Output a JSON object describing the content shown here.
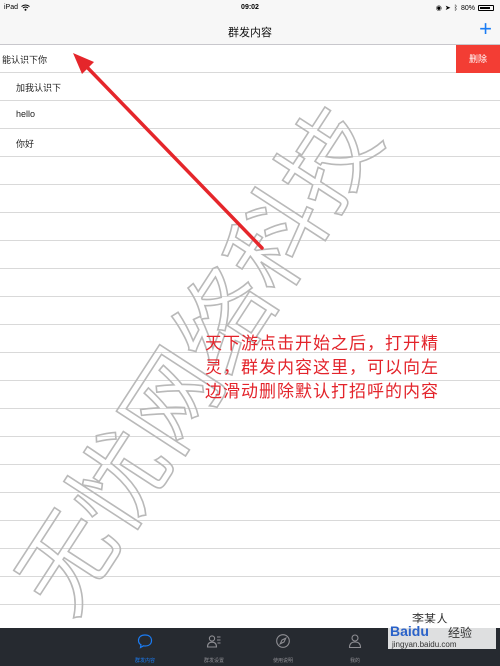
{
  "status_bar": {
    "device": "iPad",
    "time": "09:02",
    "battery": "80%"
  },
  "nav": {
    "title": "群发内容",
    "add_icon": "plus-icon"
  },
  "list": {
    "rows": [
      {
        "text": "能认识下你",
        "swiped": true
      },
      {
        "text": "加我认识下",
        "swiped": false
      },
      {
        "text": "hello",
        "swiped": false
      },
      {
        "text": "你好",
        "swiped": false
      }
    ],
    "delete_label": "删除"
  },
  "tab_bar": {
    "tabs": [
      {
        "label": "群发内容",
        "icon": "chat-bubble-icon",
        "active": true
      },
      {
        "label": "群发设置",
        "icon": "contacts-icon",
        "active": false
      },
      {
        "label": "使用说明",
        "icon": "compass-icon",
        "active": false
      },
      {
        "label": "我的",
        "icon": "person-icon",
        "active": false
      }
    ]
  },
  "annotation": {
    "lines": [
      "天下游点击开始之后，打开精",
      "灵，群发内容这里，可以向左",
      "边滑动删除默认打招呼的内容"
    ],
    "color": "#e3242b"
  },
  "watermark": {
    "text": "无忧网络科技",
    "author": "李某人",
    "baidu_logo": "Baidu",
    "baidu_suffix": "经验",
    "baidu_url": "jingyan.baidu.com"
  },
  "colors": {
    "accent": "#1a7cf4",
    "delete": "#f33d34",
    "tabbar_bg": "#262a30"
  }
}
